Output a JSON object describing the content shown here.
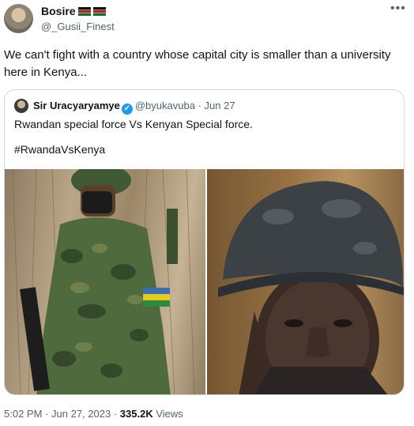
{
  "tweet": {
    "author_name": "Bosire",
    "author_handle": "@_Gusii_Finest",
    "text": "We can't fight with a country whose capital city is smaller than a university here in Kenya...",
    "time": "5:02 PM",
    "date": "Jun 27, 2023",
    "views_count": "335.2K",
    "views_label": "Views",
    "separator": "·",
    "more_icon": "•••"
  },
  "quoted": {
    "author_name": "Sir Uracyaryamye",
    "author_handle": "@byukavuba",
    "date": "Jun 27",
    "text": "Rwandan special force Vs Kenyan Special force.",
    "hashtag": "#RwandaVsKenya",
    "verified_mark": "✓"
  },
  "colors": {
    "accent": "#1d9bf0",
    "secondary_text": "#536471",
    "border": "#cfd9de"
  }
}
